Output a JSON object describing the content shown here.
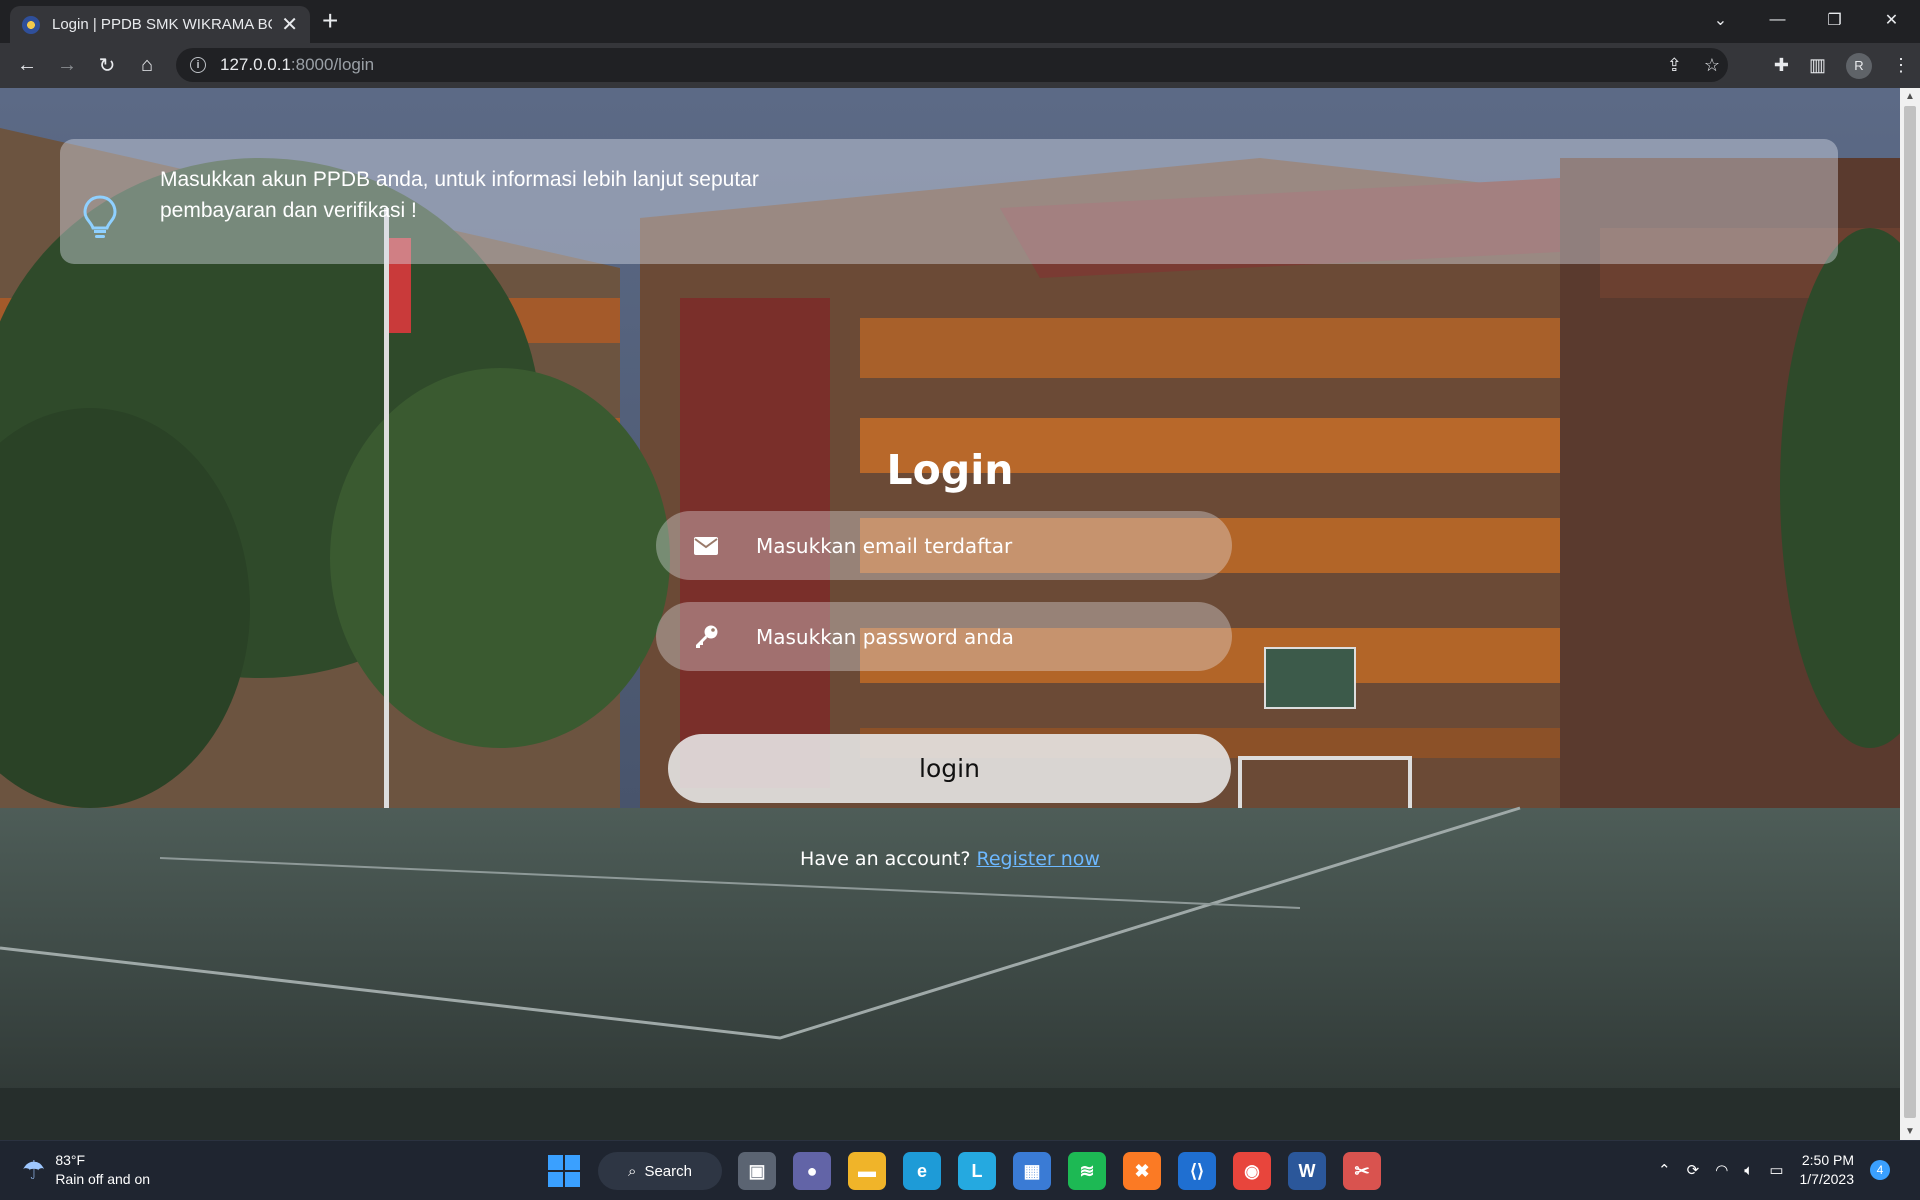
{
  "browser": {
    "tab_title": "Login | PPDB SMK WIKRAMA BOGOR",
    "tab_close": "✕",
    "new_tab": "+",
    "url_host": "127.0.0.1",
    "url_rest": ":8000/login",
    "profile_initial": "R"
  },
  "page": {
    "alert_text": "Masukkan akun PPDB anda, untuk informasi lebih lanjut seputar pembayaran dan verifikasi !",
    "title": "Login",
    "email_placeholder": "Masukkan email terdaftar",
    "password_placeholder": "Masukkan password anda",
    "login_button": "login",
    "register_prompt": "Have an account?",
    "register_link": "Register now"
  },
  "taskbar": {
    "weather_temp": "83°F",
    "weather_desc": "Rain off and on",
    "search_label": "Search",
    "time": "2:50 PM",
    "date": "1/7/2023",
    "notification_count": "4",
    "apps": [
      {
        "name": "task-view",
        "color": "#5b6472",
        "glyph": "▣"
      },
      {
        "name": "teams",
        "color": "#6264a7",
        "glyph": "●"
      },
      {
        "name": "file-explorer",
        "color": "#f0b429",
        "glyph": "▬"
      },
      {
        "name": "edge",
        "color": "#1e9bd7",
        "glyph": "e"
      },
      {
        "name": "lens",
        "color": "#25a9e0",
        "glyph": "L"
      },
      {
        "name": "microsoft-store",
        "color": "#3a7bd5",
        "glyph": "▦"
      },
      {
        "name": "spotify",
        "color": "#1db954",
        "glyph": "≋"
      },
      {
        "name": "xampp",
        "color": "#fb7a24",
        "glyph": "✖"
      },
      {
        "name": "vscode",
        "color": "#1f6fd1",
        "glyph": "⟨⟩"
      },
      {
        "name": "chrome",
        "color": "#e8453c",
        "glyph": "◉"
      },
      {
        "name": "word",
        "color": "#2b579a",
        "glyph": "W"
      },
      {
        "name": "snipping-tool",
        "color": "#d9534f",
        "glyph": "✂"
      }
    ]
  },
  "colors": {
    "link": "#6db8ff",
    "chrome_dark": "#202124",
    "chrome_toolbar": "#35363a"
  }
}
